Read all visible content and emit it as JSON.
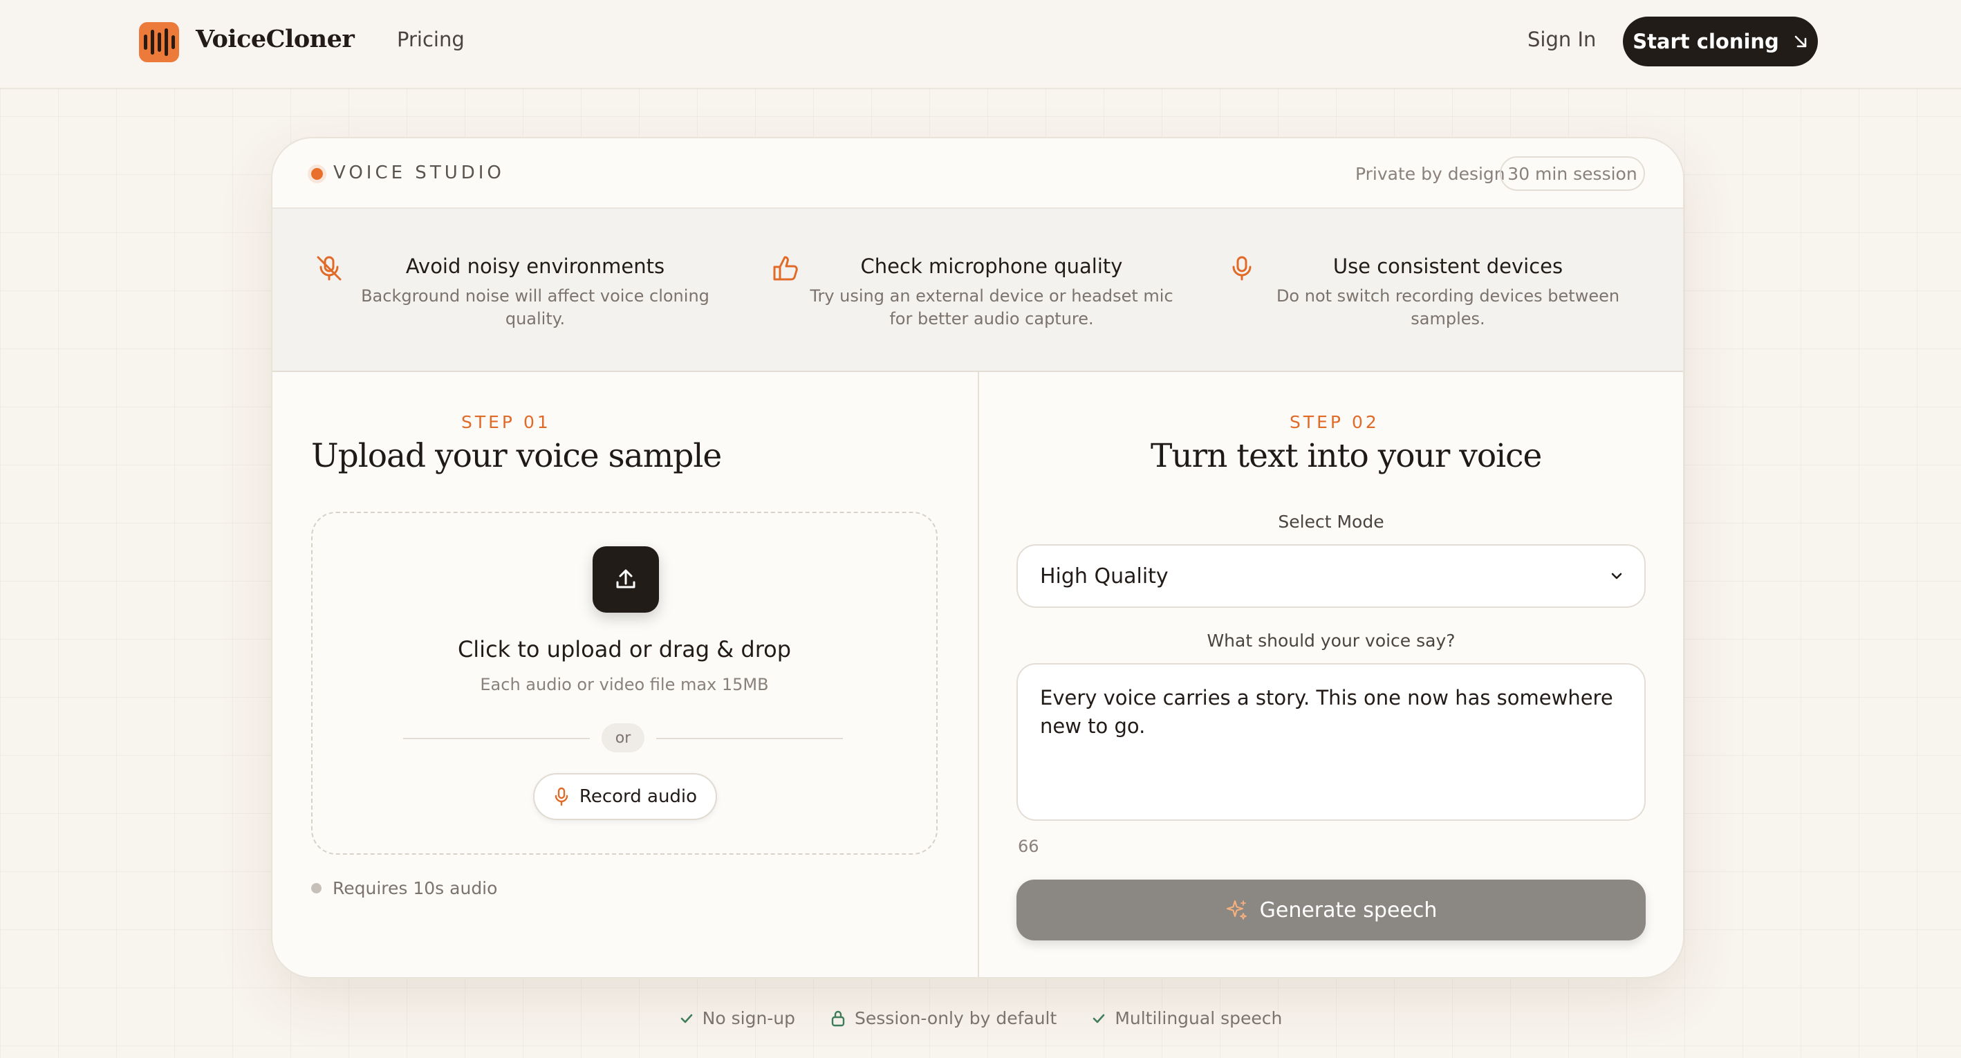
{
  "header": {
    "brand": "VoiceCloner",
    "nav_pricing": "Pricing",
    "sign_in": "Sign In",
    "cta": "Start cloning",
    "accent_color": "#ec7a3a"
  },
  "studio": {
    "label": "VOICE STUDIO",
    "private_text": "Private by design",
    "session_badge": "30 min session"
  },
  "tips": [
    {
      "icon": "mic-off-icon",
      "title": "Avoid noisy environments",
      "desc": "Background noise will affect voice cloning quality."
    },
    {
      "icon": "thumbs-up-icon",
      "title": "Check microphone quality",
      "desc": "Try using an external device or headset mic for better audio capture."
    },
    {
      "icon": "microphone-icon",
      "title": "Use consistent devices",
      "desc": "Do not switch recording devices between samples."
    }
  ],
  "step1": {
    "step_label": "STEP 01",
    "heading": "Upload your voice sample",
    "upload_title": "Click to upload or drag & drop",
    "upload_subtitle": "Each audio or video file max 15MB",
    "or_text": "or",
    "record_label": "Record audio",
    "requirement": "Requires 10s audio"
  },
  "step2": {
    "step_label": "STEP 02",
    "heading": "Turn text into your voice",
    "mode_label": "Select Mode",
    "mode_value": "High Quality",
    "text_label": "What should your voice say?",
    "text_value": "Every voice carries a story. This one now has somewhere new to go.",
    "char_count": "66",
    "generate_label": "Generate speech"
  },
  "footer": {
    "items": [
      "No sign-up",
      "Session-only by default",
      "Multilingual speech"
    ]
  }
}
